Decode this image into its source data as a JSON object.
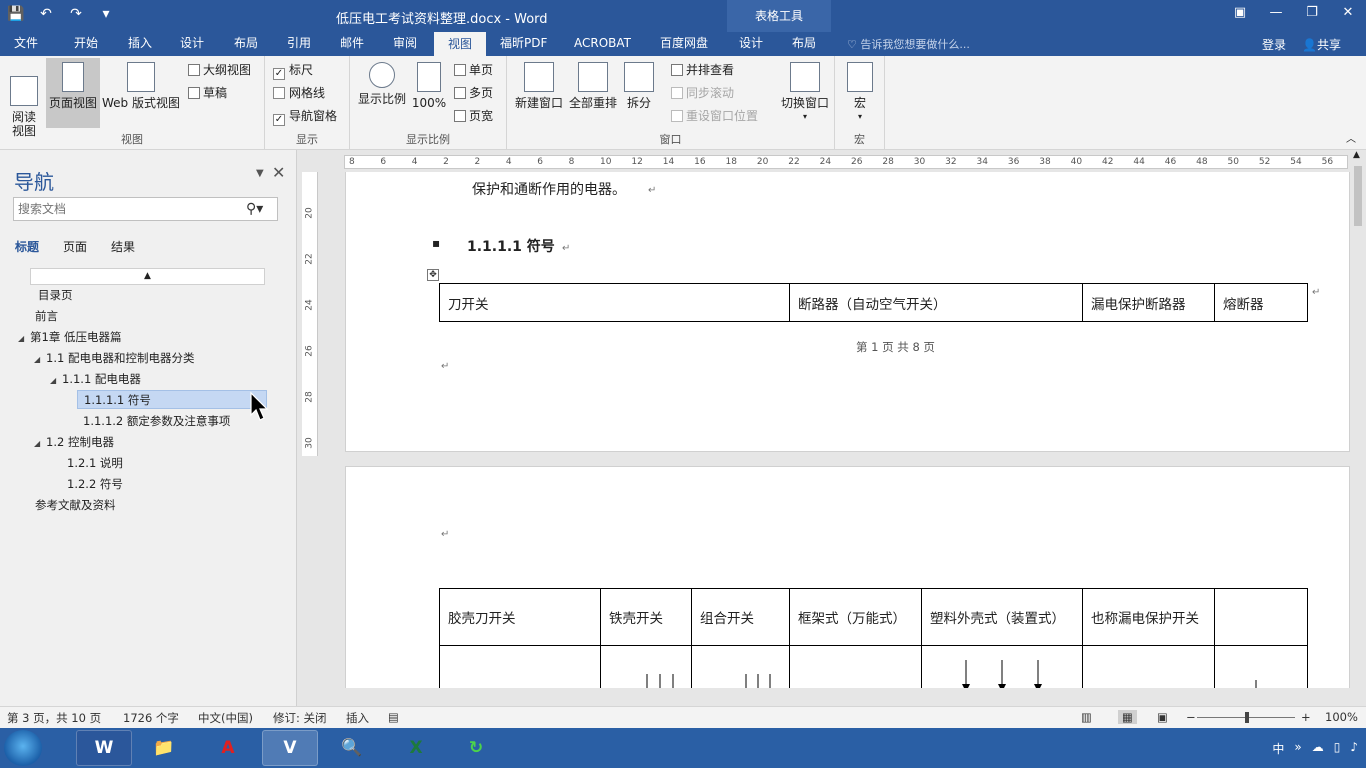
{
  "titlebar": {
    "title": "低压电工考试资料整理.docx - Word",
    "context_tools": "表格工具",
    "qat": [
      "save-icon",
      "undo-icon",
      "redo-icon",
      "customize-icon"
    ]
  },
  "tabs": [
    "文件",
    "开始",
    "插入",
    "设计",
    "布局",
    "引用",
    "邮件",
    "审阅",
    "视图",
    "福昕PDF",
    "ACROBAT",
    "百度网盘",
    "设计",
    "布局"
  ],
  "active_tab": "视图",
  "tellme": "告诉我您想要做什么...",
  "login": "登录",
  "share": "共享",
  "ribbon": {
    "views": {
      "read": "阅读\n视图",
      "print": "页面视图",
      "web": "Web 版式视图",
      "outline": "大纲视图",
      "draft": "草稿",
      "label": "视图"
    },
    "show": {
      "ruler": "标尺",
      "gridlines": "网格线",
      "navpane": "导航窗格",
      "ruler_checked": true,
      "gridlines_checked": false,
      "navpane_checked": true,
      "label": "显示"
    },
    "zoom": {
      "zoom": "显示比例",
      "hundred": "100%",
      "one_page": "单页",
      "multi_page": "多页",
      "page_width": "页宽",
      "label": "显示比例"
    },
    "window": {
      "new_window": "新建窗口",
      "arrange_all": "全部重排",
      "split": "拆分",
      "side_by_side": "并排查看",
      "sync_scroll": "同步滚动",
      "reset_pos": "重设窗口位置",
      "switch": "切换窗口",
      "label": "窗口"
    },
    "macros": {
      "macros": "宏",
      "label": "宏"
    }
  },
  "nav": {
    "title": "导航",
    "search_placeholder": "搜索文档",
    "tabs": [
      "标题",
      "页面",
      "结果"
    ],
    "items": [
      {
        "text": "目录页",
        "level": 0
      },
      {
        "text": "前言",
        "level": 0
      },
      {
        "text": "第1章 低压电器篇",
        "level": 0
      },
      {
        "text": "1.1  配电电器和控制电器分类",
        "level": 1
      },
      {
        "text": "1.1.1 配电电器",
        "level": 2
      },
      {
        "text": "1.1.1.1  符号",
        "level": 3
      },
      {
        "text": "1.1.1.2  额定参数及注意事项",
        "level": 3
      },
      {
        "text": "1.2  控制电器",
        "level": 1
      },
      {
        "text": "1.2.1 说明",
        "level": 2
      },
      {
        "text": "1.2.2 符号",
        "level": 2
      },
      {
        "text": "参考文献及资料",
        "level": 0
      }
    ]
  },
  "ruler": {
    "h_labels": [
      "8",
      "6",
      "4",
      "2",
      "2",
      "4",
      "6",
      "8",
      "10",
      "12",
      "14",
      "16",
      "18",
      "20",
      "22",
      "24",
      "26",
      "28",
      "30",
      "32",
      "34",
      "36",
      "38",
      "40",
      "42",
      "44",
      "46",
      "48",
      "50",
      "52",
      "54",
      "56"
    ],
    "v_labels": [
      "20",
      "22",
      "24",
      "26",
      "28",
      "30"
    ]
  },
  "document": {
    "page1_text": "保护和通断作用的电器。",
    "bullet": "▪",
    "heading": "1.1.1.1  符号",
    "table1": [
      "刀开关",
      "断路器（自动空气开关）",
      "漏电保护断路器",
      "熔断器"
    ],
    "footer": "第 1 页 共 8 页",
    "table2": [
      "胶壳刀开关",
      "铁壳开关",
      "组合开关",
      "框架式（万能式）",
      "塑料外壳式（装置式）",
      "也称漏电保护开关",
      ""
    ]
  },
  "status": {
    "page": "第 3 页，共 10 页",
    "words": "1726 个字",
    "lang": "中文(中国)",
    "track": "修订: 关闭",
    "insert": "插入",
    "zoom": "100%",
    "zoom_level": 0.5
  },
  "taskbar": {
    "apps": [
      "W",
      "📁",
      "A",
      "V",
      "🔍",
      "X",
      "↻"
    ],
    "ime": "中",
    "tray_arrow": "»"
  }
}
